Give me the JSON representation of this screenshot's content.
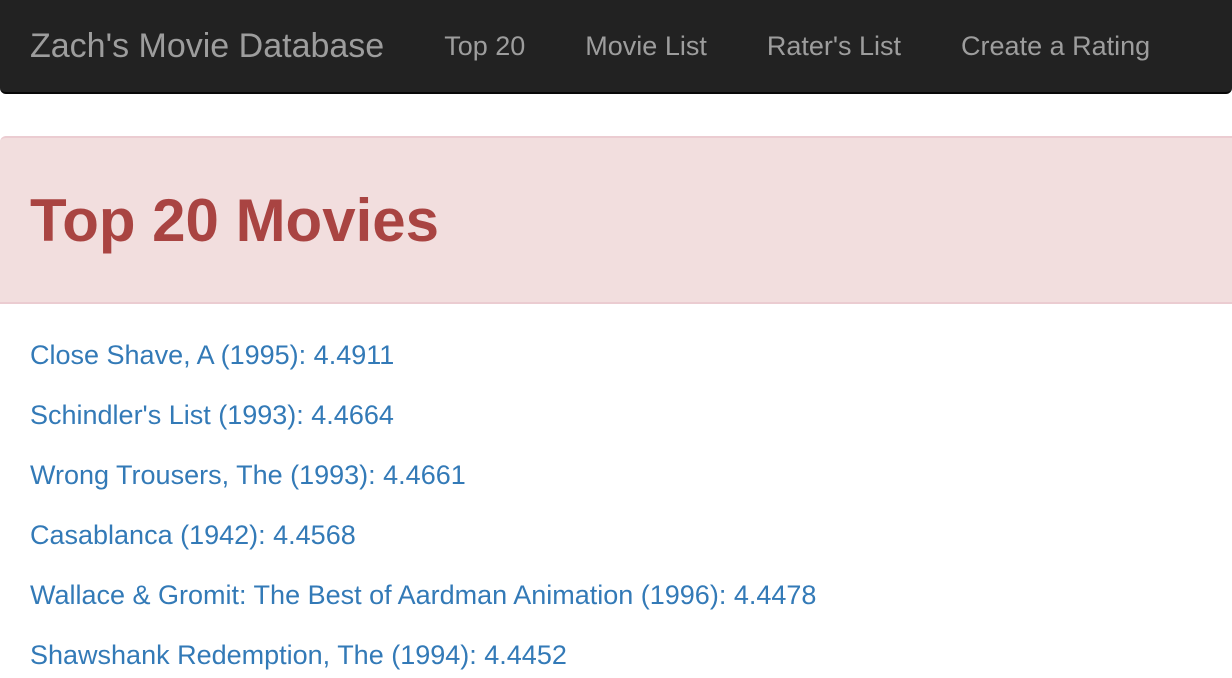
{
  "navbar": {
    "brand": "Zach's Movie Database",
    "links": [
      "Top 20",
      "Movie List",
      "Rater's List",
      "Create a Rating"
    ]
  },
  "page": {
    "title": "Top 20 Movies"
  },
  "movies": [
    "Close Shave, A (1995): 4.4911",
    "Schindler's List (1993): 4.4664",
    "Wrong Trousers, The (1993): 4.4661",
    "Casablanca (1942): 4.4568",
    "Wallace & Gromit: The Best of Aardman Animation (1996): 4.4478",
    "Shawshank Redemption, The (1994): 4.4452"
  ],
  "colors": {
    "navbar": "#222222",
    "link": "#337ab7",
    "alert_bg": "#f2dede",
    "alert_text": "#a94442"
  }
}
